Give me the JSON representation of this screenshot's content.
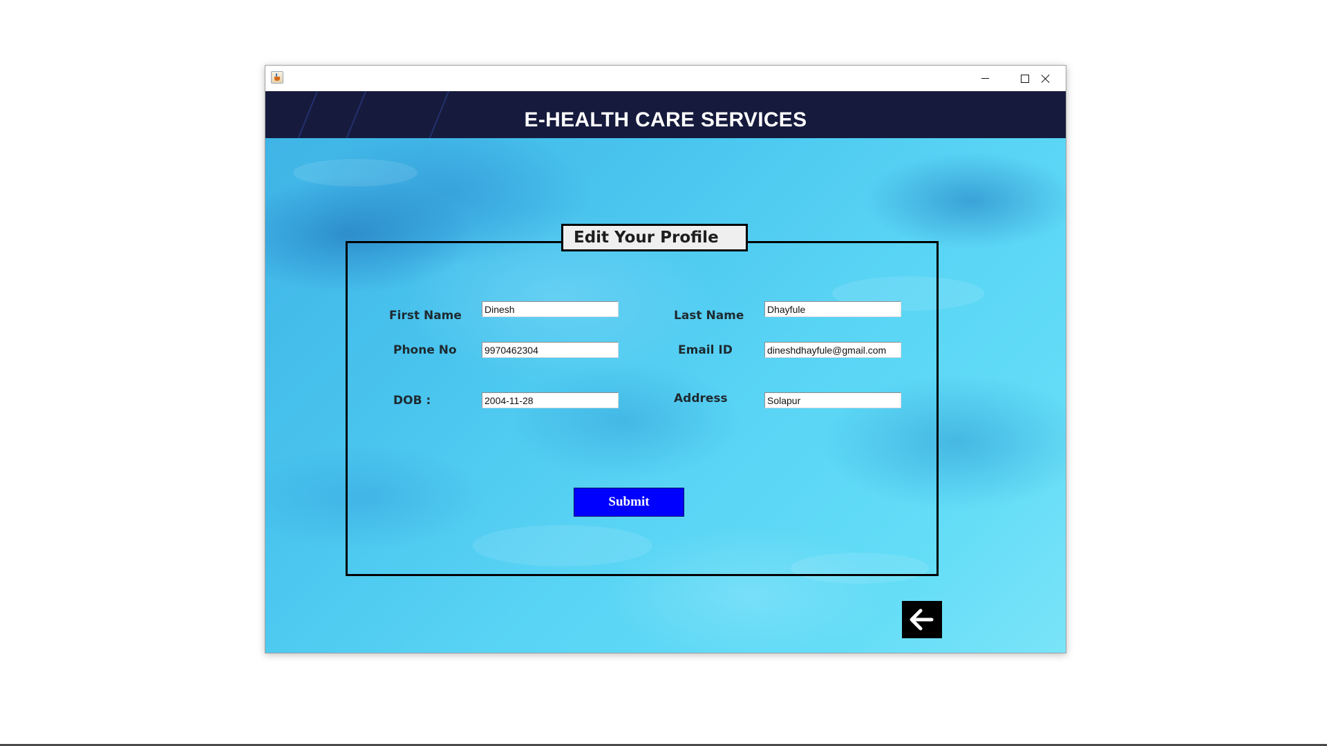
{
  "window": {
    "title": "",
    "icon": "java-cup-icon",
    "controls": [
      "minimize",
      "maximize",
      "close"
    ]
  },
  "header": {
    "title": "E-HEALTH CARE SERVICES"
  },
  "form": {
    "title": "Edit Your Profile",
    "fields": {
      "first_name": {
        "label": "First Name",
        "value": "Dinesh"
      },
      "last_name": {
        "label": "Last Name",
        "value": "Dhayfule"
      },
      "phone": {
        "label": "Phone No",
        "value": "9970462304"
      },
      "email": {
        "label": "Email ID",
        "value": "dineshdhayfule@gmail.com"
      },
      "dob": {
        "label": "DOB :",
        "value": "2004-11-28"
      },
      "address": {
        "label": "Address",
        "value": "Solapur"
      }
    },
    "submit_label": "Submit"
  },
  "navigation": {
    "back_icon": "arrow-left-icon"
  },
  "colors": {
    "header_bg": "#161b3d",
    "submit_bg": "#0000ff",
    "back_bg": "#000000",
    "water": "#4cc6ef"
  }
}
